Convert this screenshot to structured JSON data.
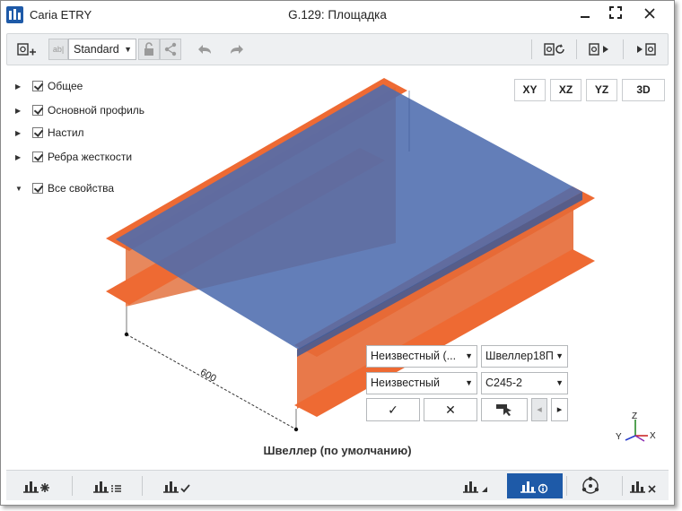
{
  "window": {
    "app_name": "Caria ETRY",
    "title": "G.129: Площадка"
  },
  "toolbar": {
    "style_value": "Standard",
    "ab_label": "ab|"
  },
  "tree": [
    {
      "label": "Общее"
    },
    {
      "label": "Основной профиль"
    },
    {
      "label": "Настил"
    },
    {
      "label": "Ребра жесткости"
    },
    {
      "label": "Все свойства"
    }
  ],
  "views": [
    "XY",
    "XZ",
    "YZ",
    "3D"
  ],
  "dimension": "600",
  "editor": {
    "field1": "Неизвестный (...",
    "field2": "Швеллер18П",
    "field3": "Неизвестный",
    "field4": "С245-2",
    "ok_glyph": "✓",
    "cancel_glyph": "✕",
    "prev_glyph": "◂",
    "next_glyph": "▸"
  },
  "axes": {
    "x": "X",
    "y": "Y",
    "z": "Z"
  },
  "caption": "Швеллер (по умолчанию)",
  "colors": {
    "accent": "#1e5aa8",
    "beam": "#ee6a33",
    "deck": "#5572a8"
  }
}
